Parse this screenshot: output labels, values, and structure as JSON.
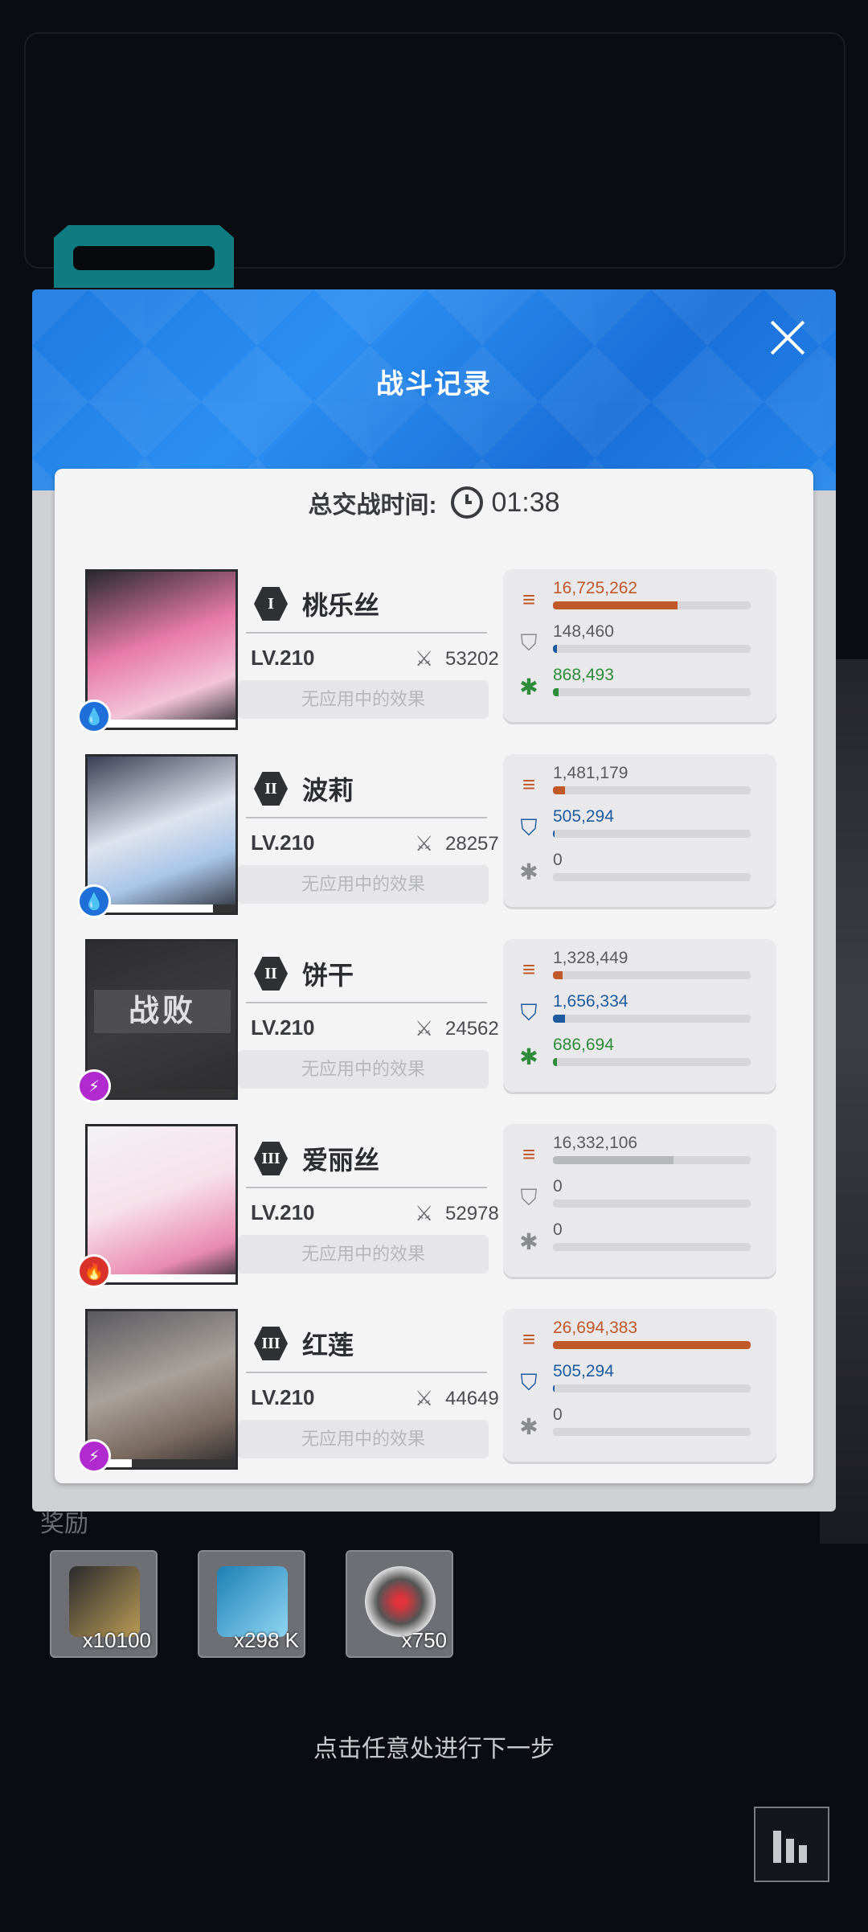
{
  "modal": {
    "title": "战斗记录",
    "total_time_label": "总交战时间:",
    "total_time": "01:38"
  },
  "colors": {
    "header_blue": "#1e7ae0",
    "damage": "#c0582a",
    "shield": "#1e5aa0",
    "heal": "#2e8b3a",
    "neutral": "#9c9da1"
  },
  "characters": [
    {
      "rank": "I",
      "name": "桃乐丝",
      "level": "LV.210",
      "power": "53202",
      "effect": "无应用中的效果",
      "element_icon": "water-icon",
      "element_color": "#1e6fd8",
      "hp_fraction": 1.0,
      "defeated": false,
      "damage": "16,725,262",
      "damage_fraction": 0.63,
      "shield": "148,460",
      "shield_fraction": 0.0,
      "heal": "868,493",
      "heal_fraction": 0.03
    },
    {
      "rank": "II",
      "name": "波莉",
      "level": "LV.210",
      "power": "28257",
      "effect": "无应用中的效果",
      "element_icon": "water-icon",
      "element_color": "#1e6fd8",
      "hp_fraction": 0.85,
      "defeated": false,
      "damage": "1,481,179",
      "damage_fraction": 0.06,
      "shield": "505,294",
      "shield_fraction": 0.01,
      "heal": "0",
      "heal_fraction": 0.0
    },
    {
      "rank": "II",
      "name": "饼干",
      "level": "LV.210",
      "power": "24562",
      "effect": "无应用中的效果",
      "element_icon": "electric-icon",
      "element_color": "#b02ad0",
      "hp_fraction": 0.0,
      "defeated": true,
      "defeated_label": "战败",
      "damage": "1,328,449",
      "damage_fraction": 0.05,
      "shield": "1,656,334",
      "shield_fraction": 0.06,
      "heal": "686,694",
      "heal_fraction": 0.02
    },
    {
      "rank": "III",
      "name": "爱丽丝",
      "level": "LV.210",
      "power": "52978",
      "effect": "无应用中的效果",
      "element_icon": "fire-icon",
      "element_color": "#d8322a",
      "hp_fraction": 1.0,
      "defeated": false,
      "damage": "16,332,106",
      "damage_fraction": 0.61,
      "shield": "0",
      "shield_fraction": 0.0,
      "heal": "0",
      "heal_fraction": 0.0
    },
    {
      "rank": "III",
      "name": "红莲",
      "level": "LV.210",
      "power": "44649",
      "effect": "无应用中的效果",
      "element_icon": "electric-icon",
      "element_color": "#b02ad0",
      "hp_fraction": 0.3,
      "defeated": false,
      "damage": "26,694,383",
      "damage_fraction": 1.0,
      "shield": "505,294",
      "shield_fraction": 0.01,
      "heal": "0",
      "heal_fraction": 0.0
    }
  ],
  "rewards": {
    "label": "奖励",
    "items": [
      {
        "icon": "credit-card-icon",
        "qty": "x10100"
      },
      {
        "icon": "usb-drive-icon",
        "qty": "x298 K"
      },
      {
        "icon": "core-orb-icon",
        "qty": "x750"
      }
    ]
  },
  "hint": "点击任意处进行下一步"
}
